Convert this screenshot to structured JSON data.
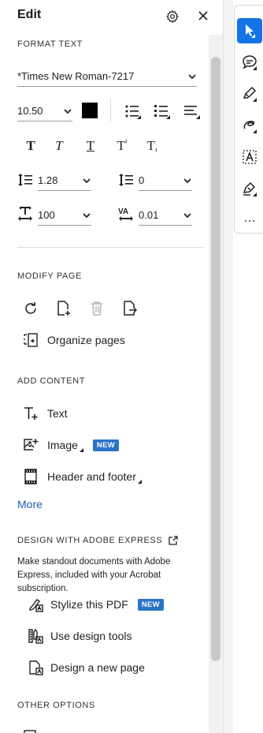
{
  "panel": {
    "title": "Edit"
  },
  "format_text": {
    "label": "FORMAT TEXT",
    "font_family": "*Times New Roman-7217",
    "font_size": "10.50",
    "color": "#000000",
    "line_spacing": "1.28",
    "paragraph_spacing": "0",
    "horizontal_scale": "100",
    "char_spacing": "0.01"
  },
  "modify_page": {
    "label": "MODIFY PAGE",
    "organize": "Organize pages"
  },
  "add_content": {
    "label": "ADD CONTENT",
    "text": "Text",
    "image": "Image",
    "image_badge": "NEW",
    "header_footer": "Header and footer",
    "more": "More"
  },
  "design": {
    "label": "DESIGN WITH ADOBE EXPRESS",
    "description": "Make standout documents with Adobe Express, included with your Acrobat subscription.",
    "stylize": "Stylize this PDF",
    "stylize_badge": "NEW",
    "design_tools": "Use design tools",
    "new_page": "Design a new page"
  },
  "other": {
    "label": "OTHER OPTIONS"
  },
  "toolbar": {
    "more": "…"
  },
  "colors": {
    "accent": "#1473e6",
    "badge": "#2b73c8",
    "link": "#1a5fb4"
  }
}
